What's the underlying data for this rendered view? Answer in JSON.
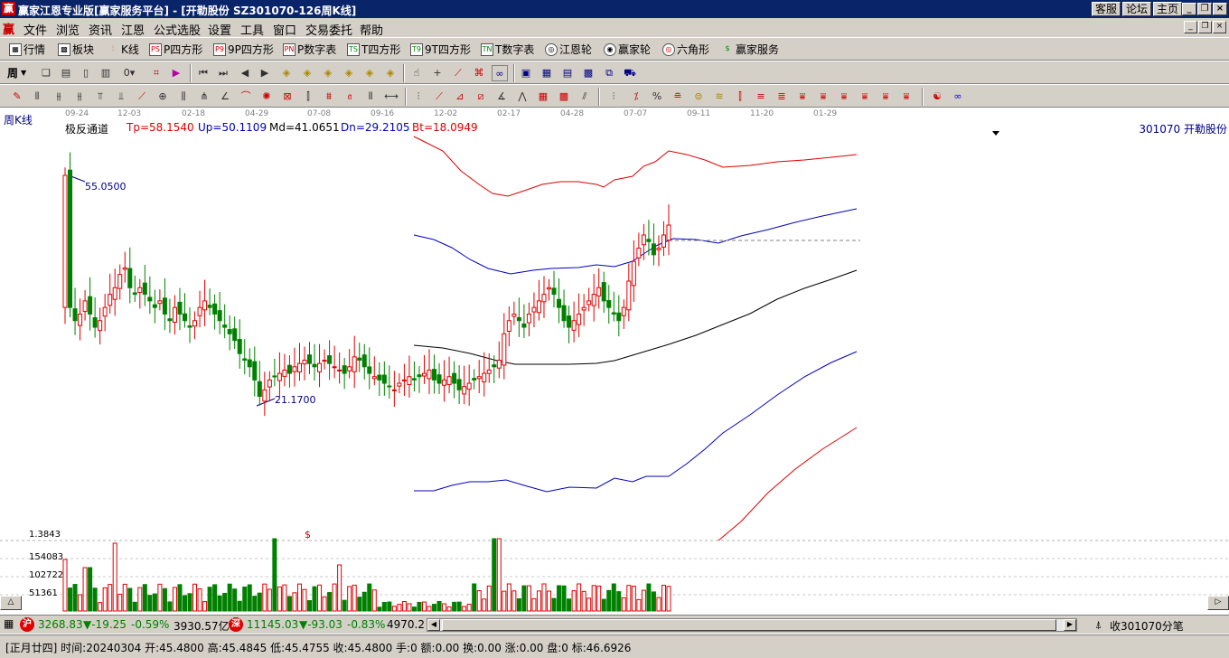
{
  "titlebar": {
    "app_icon": "赢",
    "title": "赢家江恩专业版[赢家服务平台] - [开勒股份  SZ301070-126周K线]",
    "links": [
      "客服",
      "论坛",
      "主页"
    ]
  },
  "menubar": {
    "logo": "赢",
    "items": [
      "文件",
      "浏览",
      "资讯",
      "江恩",
      "公式选股",
      "设置",
      "工具",
      "窗口",
      "交易委托",
      "帮助"
    ]
  },
  "toolbar1": {
    "buttons": [
      {
        "label": "行情",
        "icon": "quote-icon"
      },
      {
        "label": "板块",
        "icon": "sector-icon"
      },
      {
        "label": "K线",
        "icon": "kline-icon"
      },
      {
        "label": "P四方形",
        "icon": "p-square-icon"
      },
      {
        "label": "9P四方形",
        "icon": "9p-square-icon"
      },
      {
        "label": "P数字表",
        "icon": "p-table-icon"
      },
      {
        "label": "T四方形",
        "icon": "t-square-icon"
      },
      {
        "label": "9T四方形",
        "icon": "9t-square-icon"
      },
      {
        "label": "T数字表",
        "icon": "t-table-icon"
      },
      {
        "label": "江恩轮",
        "icon": "gann-wheel-icon"
      },
      {
        "label": "赢家轮",
        "icon": "winner-wheel-icon"
      },
      {
        "label": "六角形",
        "icon": "hexagon-icon"
      },
      {
        "label": "赢家服务",
        "icon": "service-icon"
      }
    ]
  },
  "toolbar2": {
    "period_select": "周"
  },
  "chart": {
    "period_label": "周K线",
    "date_ticks": [
      "09-24",
      "12-03",
      "02-18",
      "04-29",
      "07-08",
      "09-16",
      "12-02",
      "02-17",
      "04-28",
      "07-07",
      "09-11",
      "11-20",
      "01-29"
    ],
    "indicator_name": "极反通道",
    "indicator_values": {
      "tp": "Tp=58.1540",
      "up": "Up=50.1109",
      "md": "Md=41.0651",
      "dn": "Dn=29.2105",
      "bt": "Bt=18.0949"
    },
    "stock_label": "301070 开勒股份",
    "high_annotation": "55.0500",
    "low_annotation": "21.1700",
    "volume_scale_top": "1.3843",
    "volume_labels": [
      "154083",
      "102722",
      "51361"
    ],
    "dollar_marker": "$",
    "colors": {
      "up_candle": "#e00000",
      "down_candle": "#008000",
      "tp_line": "#e00000",
      "up_line": "#0000c0",
      "md_line": "#000000",
      "dn_line": "#0000c0",
      "bt_line": "#e00000"
    }
  },
  "chart_data": {
    "type": "candlestick",
    "title": "周K线",
    "candles_close_approx": [
      55.05,
      33.0,
      36.5,
      35.8,
      37.0,
      40.0,
      36.0,
      37.5,
      35.0,
      34.0,
      31.5,
      29.0,
      26.5,
      21.17,
      24.5,
      26.5,
      28.0,
      29.5,
      28.0,
      27.0,
      26.5,
      25.0,
      24.5,
      26.0,
      25.0,
      26.5,
      27.0,
      31.0,
      34.0,
      36.0,
      39.0,
      36.5,
      35.0,
      41.0,
      43.5,
      47.5,
      45.0,
      48.0
    ],
    "price_range": [
      18.0,
      60.0
    ],
    "volume_scale": [
      "154083",
      "102722",
      "51361"
    ]
  },
  "statusbar1": {
    "sh_badge": "沪",
    "sh_index": "3268.83",
    "sh_change": "▼-19.25",
    "sh_pct": "-0.59%",
    "sh_amount": "3930.57亿",
    "sz_badge": "深",
    "sz_index": "11145.03",
    "sz_change": "▼-93.03",
    "sz_pct": "-0.83%",
    "sz_amount": "4970.2",
    "right_label": "收301070分笔"
  },
  "statusbar2": {
    "info": "[正月廿四]  时间:20240304  开:45.4800  高:45.4845  低:45.4755  收:45.4800  手:0  额:0.00  换:0.00  涨:0.00  盘:0  标:46.6926"
  }
}
